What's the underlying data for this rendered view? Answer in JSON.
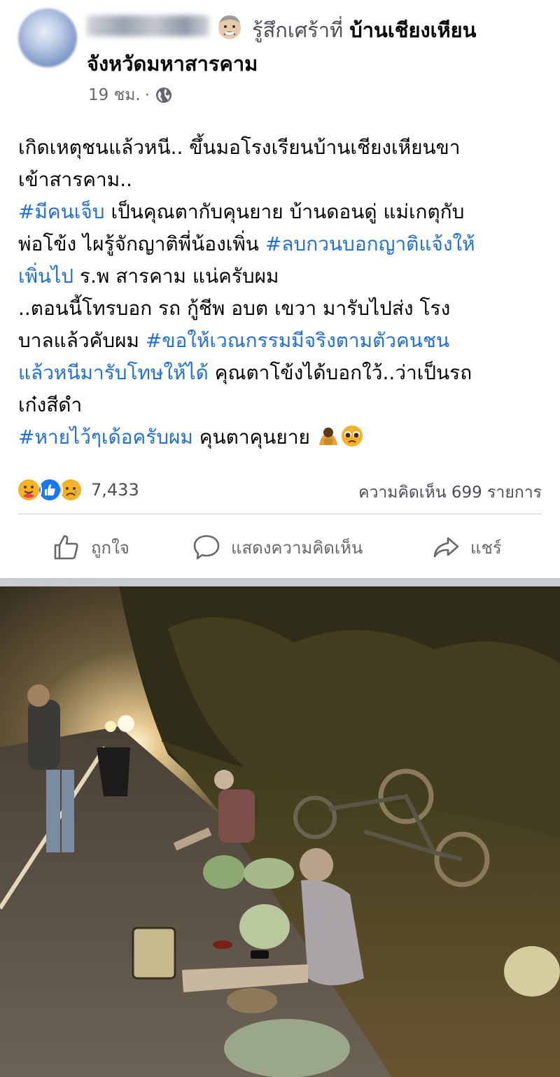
{
  "header": {
    "feeling_text": "รู้สึกเศร้าที่",
    "place_line1": "บ้านเชียงเหียน",
    "place_line2": "จังหวัดมหาสารคาม",
    "time": "19 ชม.",
    "dot": "·",
    "feeling_icon": "sad-face-icon",
    "privacy_icon": "globe-icon"
  },
  "post": {
    "lines": [
      [
        {
          "t": "เกิดเหตุชนแล้วหนี.. ขึ้นมอโรงเรียนบ้านเชียงเหียนขา"
        }
      ],
      [
        {
          "t": "เข้าสารคาม.."
        }
      ],
      [
        {
          "t": "#มีคนเจ็บ",
          "tag": true
        },
        {
          "t": " เป็นคุณตากับคุนยาย บ้านดอนดู่ แม่เกตุกับ"
        }
      ],
      [
        {
          "t": "พ่อโข้ง ไผรู้จักญาติพี่น้องเพิ่น "
        },
        {
          "t": "#ลบกวนบอกญาติแจ้งให้",
          "tag": true
        }
      ],
      [
        {
          "t": "เพิ่นไป",
          "tag": true
        },
        {
          "t": " ร.พ สารคาม แน่ครับผม"
        }
      ],
      [
        {
          "t": "..ตอนนี้โทรบอก รถ กู้ชีพ อบต เขวา มารับไปส่ง โรง"
        }
      ],
      [
        {
          "t": "บาลแล้วคับผม "
        },
        {
          "t": "#ขอให้เวณกรรมมีจริงตามตัวคนชน",
          "tag": true
        }
      ],
      [
        {
          "t": "แล้วหนีมารับโทษให้ได้",
          "tag": true
        },
        {
          "t": " คุณตาโข้งได้บอกใว้..ว่าเป็นรถ"
        }
      ],
      [
        {
          "t": "เก๋งสีดำ"
        }
      ],
      [
        {
          "t": "#หายไว้ๆเด้อครับผม",
          "tag": true
        },
        {
          "t": " คุนตาคุนยาย "
        }
      ]
    ],
    "trailing_emojis": [
      "bowing-person-icon",
      "pleading-face-icon"
    ]
  },
  "stats": {
    "reaction_icons": [
      "care-icon",
      "like-icon",
      "sad-icon"
    ],
    "reaction_count": "7,433",
    "comments": "ความคิดเห็น 699 รายการ"
  },
  "actions": {
    "like": "ถูกใจ",
    "comment": "แสดงความคิดเห็น",
    "share": "แชร์"
  },
  "colors": {
    "hashtag": "#216fdb",
    "secondary_text": "#65676b",
    "like_blue": "#1877f2"
  }
}
